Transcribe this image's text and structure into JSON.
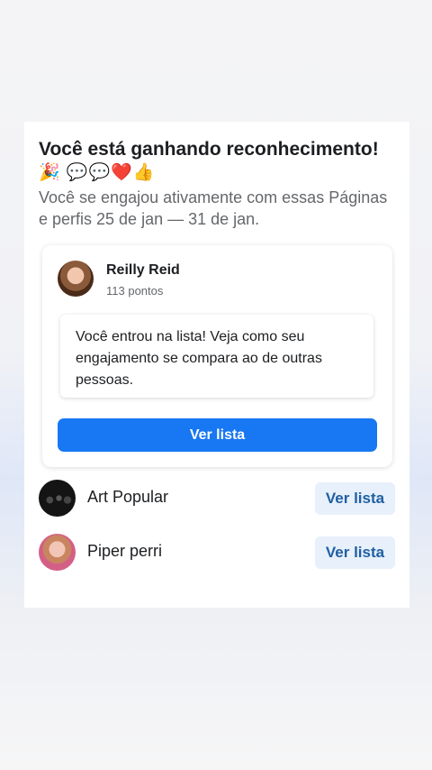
{
  "card": {
    "title": "Você está ganhando reconhecimento!",
    "emojis": "🎉 💬💬❤️👍",
    "subtitle": "Você se engajou ativamente com essas Páginas e perfis 25 de jan — 31 de jan."
  },
  "featured": {
    "name": "Reilly Reid",
    "points": "113 pontos",
    "message": "Você entrou na lista! Veja como seu engajamento se compara ao de outras pessoas.",
    "button_label": "Ver lista"
  },
  "pages": [
    {
      "name": "Art Popular",
      "button_label": "Ver lista"
    },
    {
      "name": "Piper perri",
      "button_label": "Ver lista"
    }
  ],
  "colors": {
    "primary": "#1877f2",
    "secondary_bg": "#e7f0fb",
    "secondary_text": "#1f5fa3"
  }
}
